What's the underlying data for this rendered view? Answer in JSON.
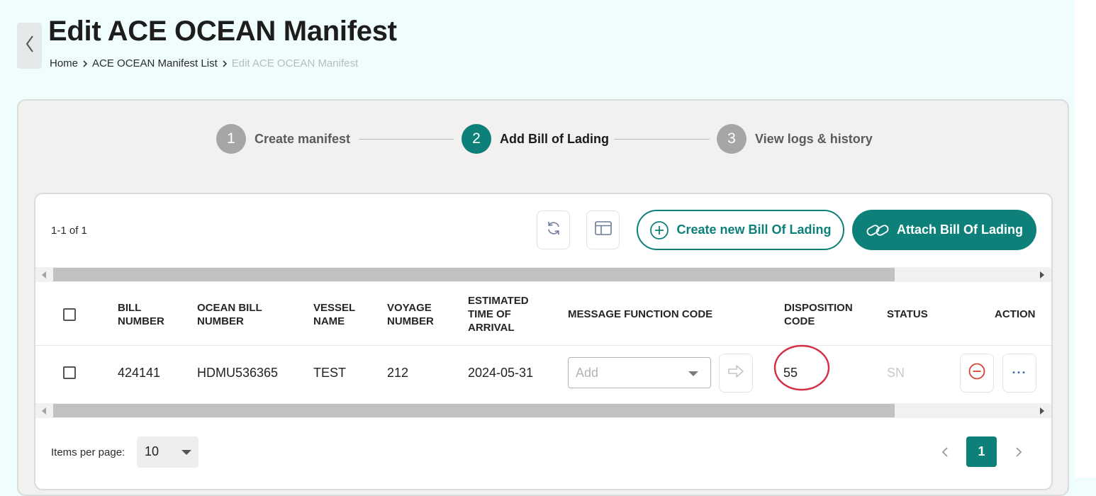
{
  "page": {
    "title": "Edit ACE OCEAN Manifest",
    "breadcrumb": [
      "Home",
      "ACE OCEAN Manifest List",
      "Edit ACE OCEAN Manifest"
    ]
  },
  "stepper": {
    "steps": [
      {
        "number": "1",
        "label": "Create manifest",
        "state": "inactive"
      },
      {
        "number": "2",
        "label": "Add Bill of Lading",
        "state": "active"
      },
      {
        "number": "3",
        "label": "View logs & history",
        "state": "inactive"
      }
    ]
  },
  "toolbar": {
    "count": "1-1 of 1",
    "create_label": "Create new Bill Of Lading",
    "attach_label": "Attach Bill Of Lading"
  },
  "table": {
    "headers": {
      "bill_number": "BILL NUMBER",
      "ocean_bill_number": "OCEAN BILL NUMBER",
      "vessel_name": "VESSEL NAME",
      "voyage_number": "VOYAGE NUMBER",
      "eta": "ESTIMATED TIME OF ARRIVAL",
      "message_function_code": "MESSAGE FUNCTION CODE",
      "disposition_code": "DISPOSITION CODE",
      "status": "STATUS",
      "action": "ACTION"
    },
    "rows": [
      {
        "bill_number": "424141",
        "ocean_bill_number": "HDMU536365",
        "vessel_name": "TEST",
        "voyage_number": "212",
        "eta": "2024-05-31",
        "message_function_code_placeholder": "Add",
        "disposition_code": "55",
        "status": "SN",
        "more": "···"
      }
    ]
  },
  "pagination": {
    "items_per_page_label": "Items per page:",
    "items_per_page": "10",
    "current_page": "1"
  },
  "colors": {
    "accent": "#0d8079",
    "annotation": "#d32f45",
    "remove_icon": "#d9452f"
  },
  "icons": {
    "back": "chevron-left-icon",
    "breadcrumb_separator": "chevron-right-icon",
    "refresh": "refresh-icon",
    "columns": "columns-layout-icon",
    "create": "plus-circle-icon",
    "attach": "link-icon",
    "apply": "arrow-right-icon",
    "remove": "minus-circle-icon",
    "more": "more-dots-icon"
  }
}
